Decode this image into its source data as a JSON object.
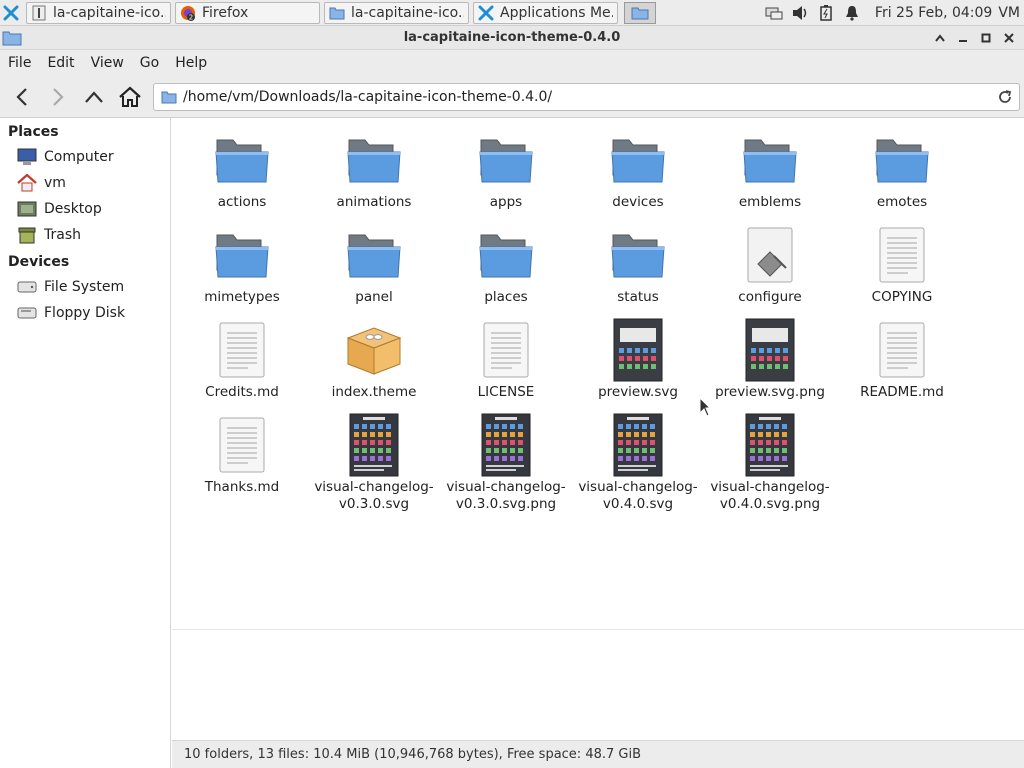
{
  "panel": {
    "tasks": [
      {
        "label": "la-capitaine-ico...",
        "icon": "terminal-icon"
      },
      {
        "label": "Firefox",
        "icon": "firefox-icon",
        "badge": "2"
      },
      {
        "label": "la-capitaine-ico...",
        "icon": "folder-icon"
      },
      {
        "label": "Applications Me...",
        "icon": "xfce-icon"
      }
    ],
    "clock": "Fri 25 Feb, 04:09",
    "user": "VM"
  },
  "window": {
    "title": "la-capitaine-icon-theme-0.4.0"
  },
  "menubar": [
    "File",
    "Edit",
    "View",
    "Go",
    "Help"
  ],
  "location": {
    "path": "/home/vm/Downloads/la-capitaine-icon-theme-0.4.0/"
  },
  "sidebar": {
    "places_header": "Places",
    "places": [
      {
        "label": "Computer",
        "icon": "computer-icon"
      },
      {
        "label": "vm",
        "icon": "home-icon"
      },
      {
        "label": "Desktop",
        "icon": "desktop-icon"
      },
      {
        "label": "Trash",
        "icon": "trash-icon"
      }
    ],
    "devices_header": "Devices",
    "devices": [
      {
        "label": "File System",
        "icon": "drive-icon"
      },
      {
        "label": "Floppy Disk",
        "icon": "floppy-icon"
      }
    ]
  },
  "files": [
    {
      "name": "actions",
      "type": "folder"
    },
    {
      "name": "animations",
      "type": "folder"
    },
    {
      "name": "apps",
      "type": "folder"
    },
    {
      "name": "devices",
      "type": "folder"
    },
    {
      "name": "emblems",
      "type": "folder"
    },
    {
      "name": "emotes",
      "type": "folder"
    },
    {
      "name": "mimetypes",
      "type": "folder"
    },
    {
      "name": "panel",
      "type": "folder"
    },
    {
      "name": "places",
      "type": "folder"
    },
    {
      "name": "status",
      "type": "folder"
    },
    {
      "name": "configure",
      "type": "script"
    },
    {
      "name": "COPYING",
      "type": "text"
    },
    {
      "name": "Credits.md",
      "type": "text"
    },
    {
      "name": "index.theme",
      "type": "package"
    },
    {
      "name": "LICENSE",
      "type": "text"
    },
    {
      "name": "preview.svg",
      "type": "image"
    },
    {
      "name": "preview.svg.png",
      "type": "image"
    },
    {
      "name": "README.md",
      "type": "text"
    },
    {
      "name": "Thanks.md",
      "type": "text"
    },
    {
      "name": "visual-changelog-v0.3.0.svg",
      "type": "image-tall"
    },
    {
      "name": "visual-changelog-v0.3.0.svg.png",
      "type": "image-tall"
    },
    {
      "name": "visual-changelog-v0.4.0.svg",
      "type": "image-tall"
    },
    {
      "name": "visual-changelog-v0.4.0.svg.png",
      "type": "image-tall"
    }
  ],
  "status": "10 folders, 13 files: 10.4 MiB (10,946,768 bytes), Free space: 48.7 GiB",
  "colors": {
    "folder_blue": "#5a9be0",
    "folder_back": "#7f8a94",
    "accent": "#3d8fe0"
  }
}
